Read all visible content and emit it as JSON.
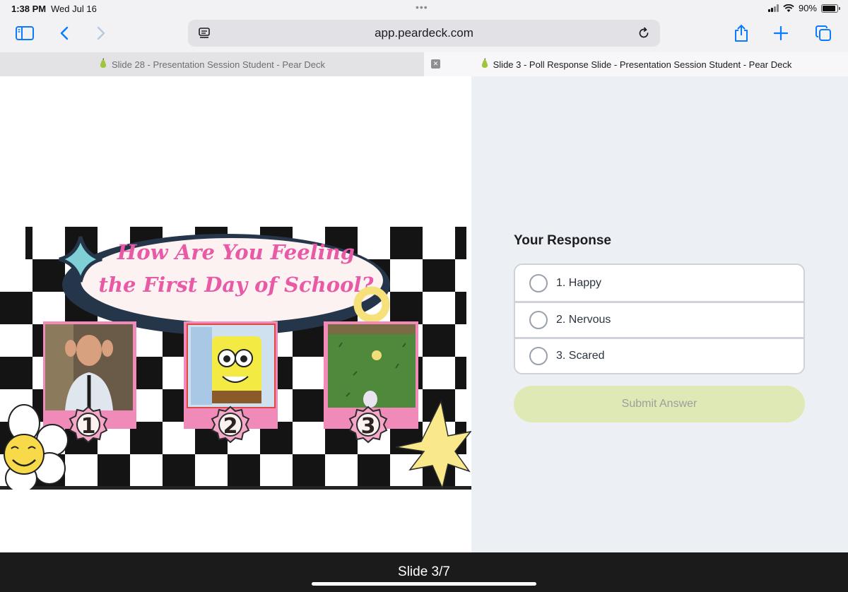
{
  "status": {
    "time": "1:38 PM",
    "date": "Wed Jul 16",
    "battery_text": "90%",
    "battery_level": 0.9
  },
  "toolbar": {
    "url": "app.peardeck.com"
  },
  "tabs": [
    {
      "title": "Slide 28 - Presentation Session Student - Pear Deck",
      "active": false
    },
    {
      "title": "Slide 3 - Poll Response Slide - Presentation Session Student - Pear Deck",
      "active": true
    }
  ],
  "slide": {
    "title_line1": "How Are You Feeling",
    "title_line2": "the First Day of School?",
    "badges": [
      "1",
      "2",
      "3"
    ]
  },
  "response": {
    "title": "Your Response",
    "options": [
      "1. Happy",
      "2. Nervous",
      "3. Scared"
    ],
    "submit_label": "Submit Answer"
  },
  "footer": {
    "slide_counter": "Slide 3/7"
  },
  "colors": {
    "accent": "#0a7aff",
    "title_pink": "#e85aa6",
    "frame_pink": "#f08ab8",
    "submit_bg": "#dfe9b6"
  }
}
